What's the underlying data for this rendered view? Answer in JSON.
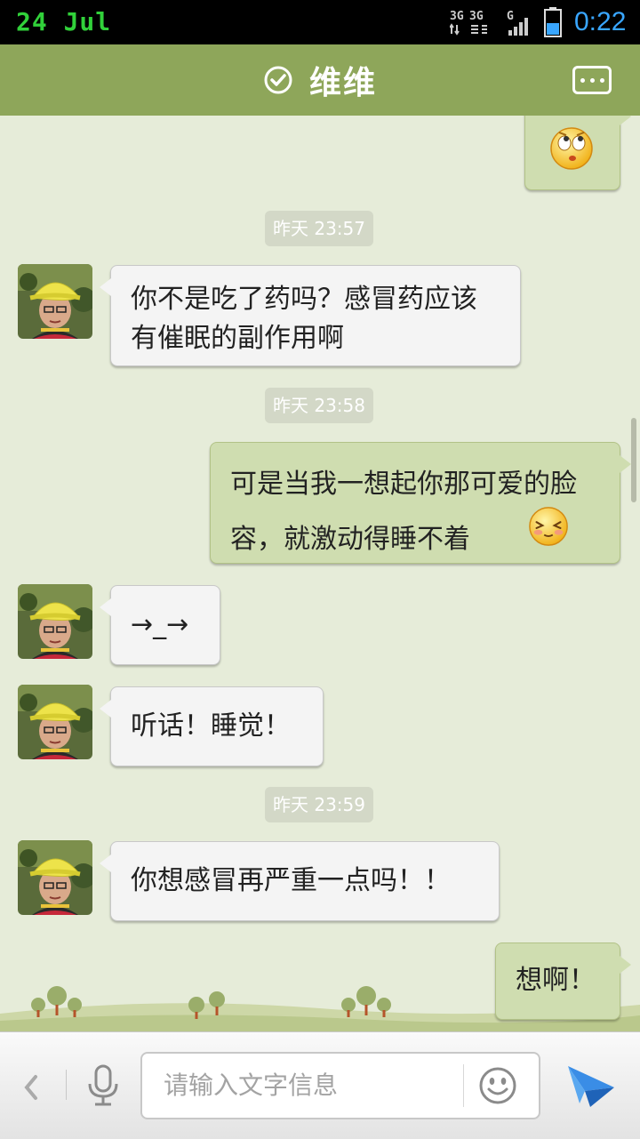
{
  "status_bar": {
    "date": "24  Jul",
    "network": "3G",
    "time": "0:22"
  },
  "header": {
    "title": "维维",
    "verified_icon": "check-circle-icon",
    "more_icon": "more-dots-icon"
  },
  "messages": [
    {
      "side": "out",
      "type": "emoji",
      "icon": "eye-roll-emoji-icon"
    },
    {
      "type": "timestamp",
      "text": "昨天 23:57"
    },
    {
      "side": "in",
      "text": "你不是吃了药吗？感冒药应该有催眠的副作用啊"
    },
    {
      "type": "timestamp",
      "text": "昨天 23:58"
    },
    {
      "side": "out",
      "text": "可是当我一想起你那可爱的脸容，就激动得睡不着",
      "trailing_emoji": "shy-emoji-icon"
    },
    {
      "side": "in",
      "text": "→_→"
    },
    {
      "side": "in",
      "text": "听话！睡觉！"
    },
    {
      "type": "timestamp",
      "text": "昨天 23:59"
    },
    {
      "side": "in",
      "text": "你想感冒再严重一点吗！！"
    },
    {
      "side": "out",
      "text": "想啊！"
    }
  ],
  "input_bar": {
    "placeholder": "请输入文字信息",
    "back_icon": "chevron-left-icon",
    "mic_icon": "microphone-icon",
    "emoji_icon": "smiley-icon",
    "send_icon": "send-arrow-icon"
  },
  "colors": {
    "header_green": "#8ea65a",
    "chat_background": "#e6ecd9",
    "outgoing_bubble": "#cfddb0",
    "incoming_bubble": "#f4f4f4",
    "time_accent": "#39a6ff",
    "date_accent": "#31d13a"
  }
}
